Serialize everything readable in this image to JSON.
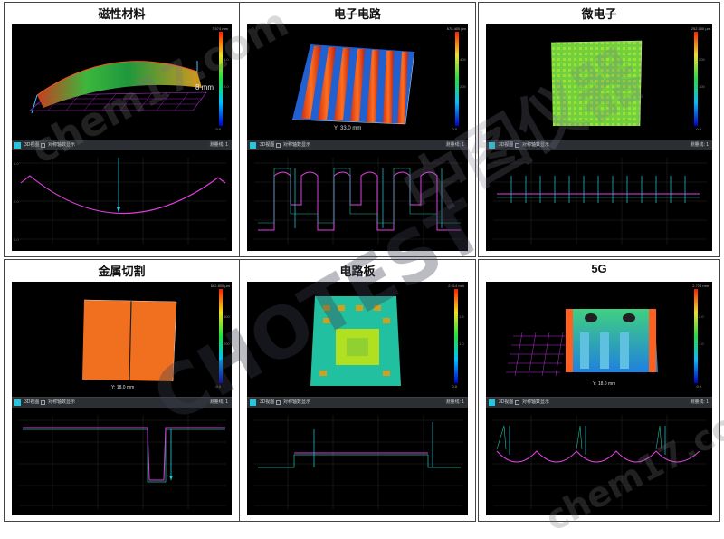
{
  "panels": [
    {
      "id": "magnetic",
      "title": "磁性材料",
      "scale_top": "7.574 mm",
      "scale_bottom": "0.0",
      "overlay_label": "8 mm",
      "toolbar_label": "3D视图",
      "toolbar_check": "对称轴数显示",
      "toolbar_right": "测量线: 1"
    },
    {
      "id": "circuit",
      "title": "电子电路",
      "scale_top": "678.400 µm",
      "scale_bottom": "0.0",
      "overlay_label": "Y: 33.0 mm",
      "toolbar_label": "3D视图",
      "toolbar_check": "对称轴数显示",
      "toolbar_right": "测量线: 1"
    },
    {
      "id": "microelectronics",
      "title": "微电子",
      "scale_top": "252.000 µm",
      "scale_bottom": "0.0",
      "overlay_label": "",
      "toolbar_label": "3D视图",
      "toolbar_check": "对称轴数显示",
      "toolbar_right": "测量线: 1"
    },
    {
      "id": "metal-cutting",
      "title": "金属切割",
      "scale_top": "662.800 µm",
      "scale_bottom": "0.0",
      "overlay_label": "Y: 18.0 mm",
      "toolbar_label": "3D视图",
      "toolbar_check": "对称轴数显示",
      "toolbar_right": "测量线: 1"
    },
    {
      "id": "pcb",
      "title": "电路板",
      "scale_top": "2.514 mm",
      "scale_bottom": "0.0",
      "overlay_label": "",
      "toolbar_label": "3D视图",
      "toolbar_check": "对称轴数显示",
      "toolbar_right": "测量线: 1"
    },
    {
      "id": "5g",
      "title": "5G",
      "scale_top": "2.724 mm",
      "scale_bottom": "0.0",
      "overlay_label": "Y: 18.0 mm",
      "toolbar_label": "3D视图",
      "toolbar_check": "对称轴数显示",
      "toolbar_right": "测量线: 1"
    }
  ],
  "watermarks": {
    "left": "chem17.com",
    "brand": "CHOTEST",
    "brand_cn": "中图仪器"
  },
  "colors": {
    "profile": "#e040e0",
    "measure": "#25d0e0",
    "scale_grad": [
      "#0000d0",
      "#00c0ff",
      "#20e040",
      "#f0e020",
      "#ff2000"
    ]
  }
}
